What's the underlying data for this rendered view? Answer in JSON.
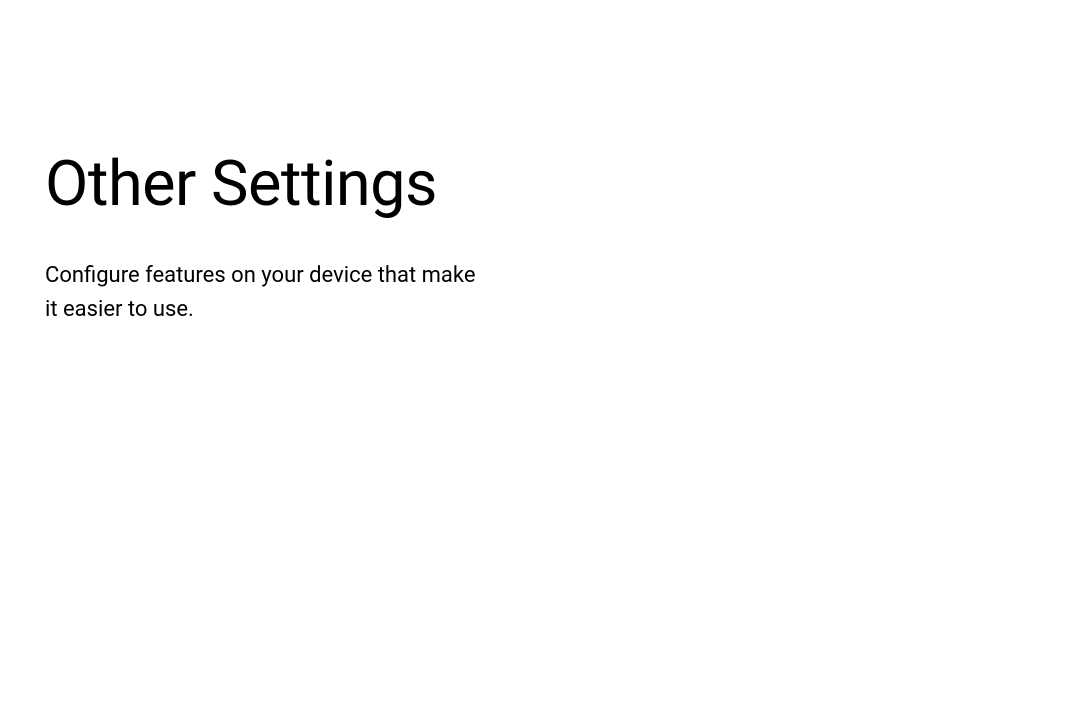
{
  "header": {
    "title": "Other Settings",
    "description": "Configure features on your device that make it easier to use."
  }
}
